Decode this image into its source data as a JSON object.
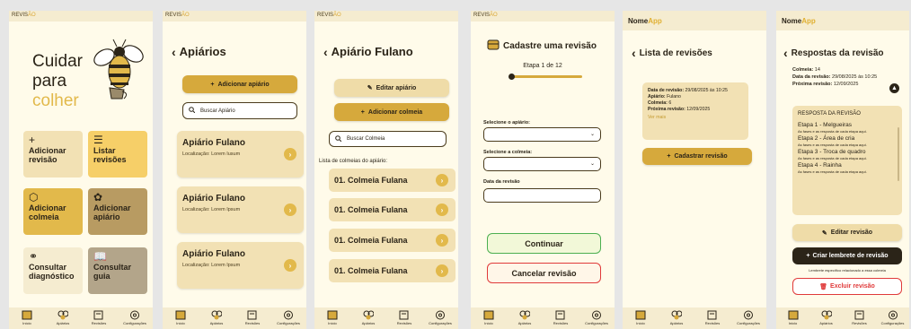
{
  "colors": {
    "gold": "#d6a93c",
    "light_gold": "#efdca8",
    "card": "#f2e1b4",
    "bg": "#fffbea",
    "topbar": "#f5ecd0",
    "green": "#4caf50",
    "red": "#e03a3a",
    "dark": "#2b2418"
  },
  "nav": {
    "inicio": "Início",
    "apiarios": "Apiários",
    "revisoes": "Revisões",
    "config": "Configurações"
  },
  "screen1": {
    "brand": "REVIS",
    "brand_accent": "ÃO",
    "hero_line1": "Cuidar",
    "hero_line2": "para",
    "hero_line3": "colher",
    "tiles": [
      {
        "icon": "plus-icon",
        "label1": "Adicionar",
        "label2": "revisão"
      },
      {
        "icon": "list-icon",
        "label1": "Listar",
        "label2": "revisões"
      },
      {
        "icon": "hive-icon",
        "label1": "Adicionar",
        "label2": "colmeia"
      },
      {
        "icon": "apiary-icon",
        "label1": "Adicionar",
        "label2": "apiário"
      },
      {
        "icon": "diagnostic-icon",
        "label1": "Consultar",
        "label2": "diagnóstico"
      },
      {
        "icon": "book-icon",
        "label1": "Consultar",
        "label2": "guia"
      }
    ]
  },
  "screen2": {
    "brand": "REVIS",
    "brand_accent": "ÃO",
    "title": "Apiários",
    "add_button": "Adicionar apiário",
    "search_placeholder": "Buscar Apiário",
    "cards": [
      {
        "name": "Apiário Fulano",
        "location": "Localização: Lorem Iusum"
      },
      {
        "name": "Apiário Fulano",
        "location": "Localização: Lorem Ipsum"
      },
      {
        "name": "Apiário Fulano",
        "location": "Localização: Lorem Ipsum"
      }
    ]
  },
  "screen3": {
    "brand": "REVIS",
    "brand_accent": "ÃO",
    "title": "Apiário Fulano",
    "edit_button": "Editar apiário",
    "add_button": "Adicionar colmeia",
    "search_placeholder": "Buscar Colmeia",
    "list_label": "Lista de colmeias do apiário:",
    "rows": [
      "01. Colmeia Fulana",
      "01. Colmeia Fulana",
      "01. Colmeia Fulana",
      "01. Colmeia Fulana"
    ]
  },
  "screen4": {
    "brand": "REVIS",
    "brand_accent": "ÃO",
    "title": "Cadastre uma revisão",
    "step": "Etapa 1 de 12",
    "progress": 0.083,
    "label_apiario": "Selecione o apiário:",
    "label_colmeia": "Selecione a colmeia:",
    "label_data": "Data da revisão",
    "continue_button": "Continuar",
    "cancel_button": "Cancelar revisão"
  },
  "screen5": {
    "app": "Nome",
    "app_accent": "App",
    "title": "Lista de revisões",
    "data_label": "Data de revisão:",
    "data_value": "29/08/2025 às 10:25",
    "apiario_label": "Apiário:",
    "apiario_value": "Fulano",
    "colmeia_label": "Colmeia:",
    "colmeia_value": "6",
    "proxima_label": "Próxima revisão:",
    "proxima_value": "12/09/2025",
    "ver_mais": "Ver mais",
    "register_button": "Cadastrar revisão"
  },
  "screen6": {
    "app": "Nome",
    "app_accent": "App",
    "title": "Respostas da revisão",
    "colmeia_label": "Colmeia:",
    "colmeia_value": "14",
    "data_label": "Data da revisão:",
    "data_value": "29/08/2025 às 10:25",
    "proxima_label": "Próxima revisão:",
    "proxima_value": "12/09/2025",
    "box_title": "RESPOSTA DA REVISÃO",
    "steps": [
      {
        "title": "Etapa 1 - Melgueiras",
        "desc": "As fases e as resposta de cada etapa aqui."
      },
      {
        "title": "Etapa 2 - Área de cria",
        "desc": "As fases e as resposta de cada etapa aqui."
      },
      {
        "title": "Etapa 3 - Troca de quadro",
        "desc": "As fases e as resposta de cada etapa aqui."
      },
      {
        "title": "Etapa 4 - Rainha",
        "desc": "As fases e as resposta de cada etapa aqui."
      }
    ],
    "edit_button": "Editar revisão",
    "reminder_button": "Criar lembrete de revisão",
    "reminder_note": "Lembrete específico relacionado a essa colmeia",
    "delete_button": "Excluir revisão"
  }
}
